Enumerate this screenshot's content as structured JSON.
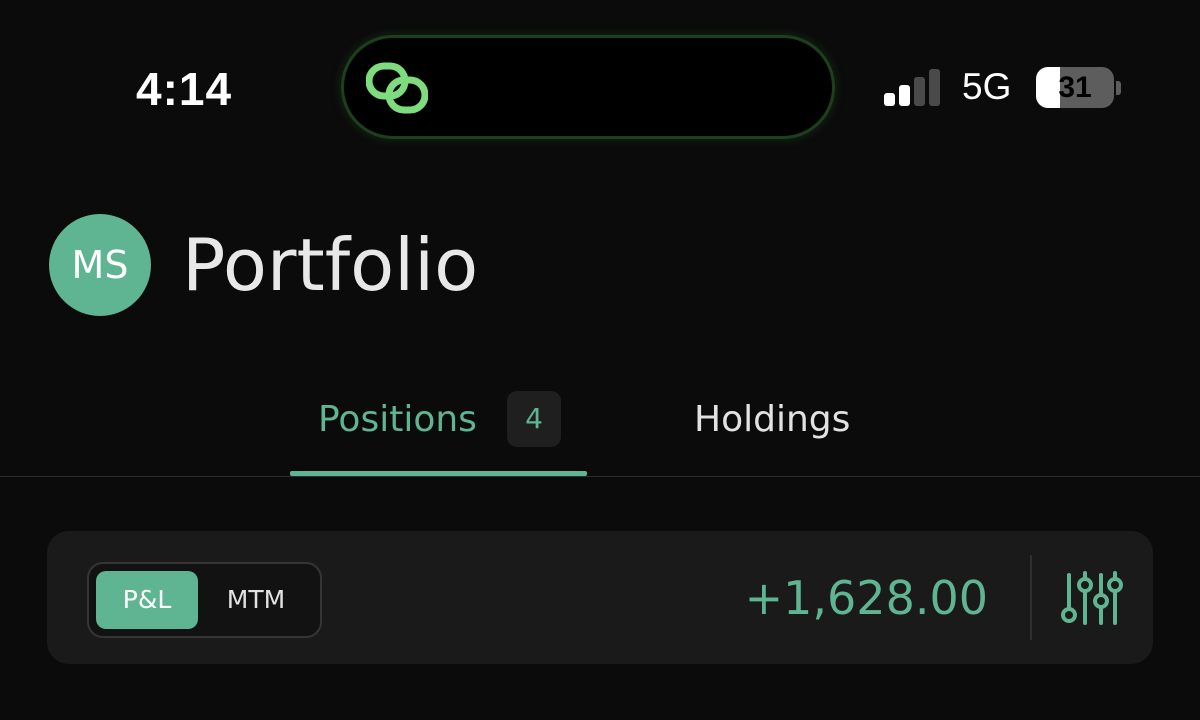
{
  "status_bar": {
    "time": "4:14",
    "network": "5G",
    "battery_percent": "31",
    "battery_level": 0.31,
    "signal_bars_active": 2,
    "signal_bars_total": 4,
    "island_icon": "link-chain-icon"
  },
  "header": {
    "avatar_initials": "MS",
    "title": "Portfolio"
  },
  "tabs": [
    {
      "label": "Positions",
      "count": "4",
      "active": true
    },
    {
      "label": "Holdings",
      "active": false
    }
  ],
  "summary": {
    "toggle_options": [
      {
        "label": "P&L",
        "selected": true
      },
      {
        "label": "MTM",
        "selected": false
      }
    ],
    "value": "+1,628.00",
    "filter_icon": "sliders-icon"
  },
  "colors": {
    "accent": "#5fb592",
    "background": "#0b0b0b",
    "card": "#1a1a1a",
    "island_accent": "#7ddc7d"
  }
}
